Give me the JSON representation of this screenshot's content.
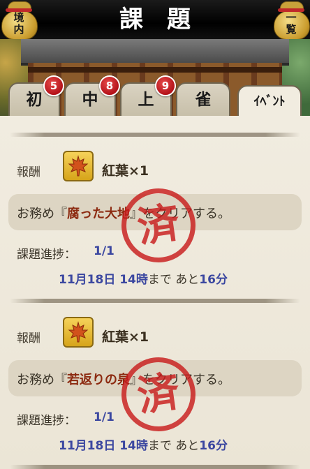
{
  "header": {
    "title": "課題",
    "left_button": {
      "line1": "境",
      "line2": "内"
    },
    "right_button": {
      "line1": "一",
      "line2": "覧"
    }
  },
  "tabs": [
    {
      "label": "初",
      "badge": "5"
    },
    {
      "label": "中",
      "badge": "8"
    },
    {
      "label": "上",
      "badge": "9"
    },
    {
      "label": "雀",
      "badge": ""
    },
    {
      "label": "ｲﾍﾞﾝﾄ",
      "badge": "",
      "active": true
    }
  ],
  "quests": [
    {
      "reward_label": "報酬",
      "reward_icon": "maple-leaf-icon",
      "reward_name": "紅葉×1",
      "mission_prefix": "お務め『",
      "mission_stage": "腐った大地",
      "mission_suffix": "』をクリアする。",
      "progress_label": "課題進捗：",
      "progress_value": "1/1",
      "deadline_date": "11月18日 14時",
      "deadline_mid": "まで あと",
      "deadline_remaining": "16分",
      "stamp": "済"
    },
    {
      "reward_label": "報酬",
      "reward_icon": "maple-leaf-icon",
      "reward_name": "紅葉×1",
      "mission_prefix": "お務め『",
      "mission_stage": "若返りの泉",
      "mission_suffix": "』をクリアする。",
      "progress_label": "課題進捗：",
      "progress_value": "1/1",
      "deadline_date": "11月18日 14時",
      "deadline_mid": "まで あと",
      "deadline_remaining": "16分",
      "stamp": "済"
    }
  ],
  "colors": {
    "accent_blue": "#3b47a0",
    "stage_red": "#8c2a10",
    "stamp_red": "#c81c1c",
    "badge_red": "#b4121a"
  }
}
